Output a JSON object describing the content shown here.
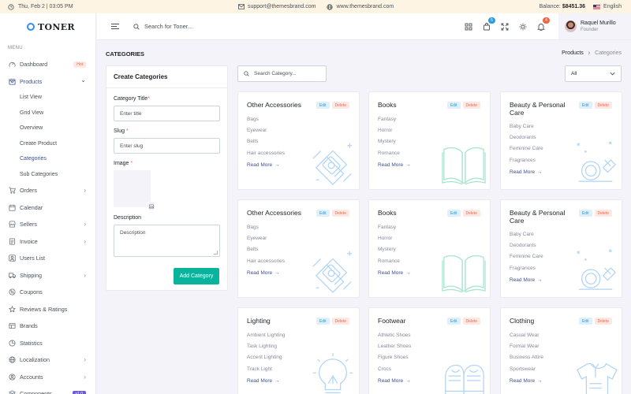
{
  "topbar": {
    "datetime": "Thu, Feb 2 | 03:05 PM",
    "email": "support@themesbrand.com",
    "website": "www.themesbrand.com",
    "balance_label": "Balance:",
    "balance_value": "$8451.36",
    "language": "English"
  },
  "brand": {
    "name": "TONER"
  },
  "sidebar": {
    "menu_title": "MENU",
    "items": [
      {
        "label": "Dashboard",
        "icon": "dashboard-icon",
        "badge": "Hot"
      },
      {
        "label": "Products",
        "icon": "box-icon",
        "active": true,
        "expanded": true,
        "children": [
          "List View",
          "Grid View",
          "Overview",
          "Create Product",
          "Categories",
          "Sub Categories"
        ],
        "active_child": "Categories"
      },
      {
        "label": "Orders",
        "icon": "cart-icon",
        "chevron": true
      },
      {
        "label": "Calendar",
        "icon": "calendar-icon"
      },
      {
        "label": "Sellers",
        "icon": "store-icon",
        "chevron": true
      },
      {
        "label": "Invoice",
        "icon": "invoice-icon",
        "chevron": true
      },
      {
        "label": "Users List",
        "icon": "users-icon"
      },
      {
        "label": "Shipping",
        "icon": "truck-icon",
        "chevron": true
      },
      {
        "label": "Coupons",
        "icon": "coupon-icon"
      },
      {
        "label": "Reviews & Ratings",
        "icon": "star-icon"
      },
      {
        "label": "Brands",
        "icon": "brand-icon"
      },
      {
        "label": "Statistics",
        "icon": "chart-icon"
      },
      {
        "label": "Localization",
        "icon": "globe-icon",
        "chevron": true
      },
      {
        "label": "Accounts",
        "icon": "account-icon",
        "chevron": true
      },
      {
        "label": "Components",
        "icon": "components-icon",
        "badge": "v1.0"
      }
    ]
  },
  "header": {
    "search_placeholder": "Search for Toner...",
    "cart_count": "5",
    "notif_count": "4",
    "user_name": "Raquel Murillo",
    "user_role": "Founder"
  },
  "page": {
    "title": "CATEGORIES",
    "breadcrumb": [
      "Products",
      "Categories"
    ]
  },
  "create_form": {
    "heading": "Create Categories",
    "title_label": "Category Title",
    "title_placeholder": "Enter title",
    "slug_label": "Slug",
    "slug_placeholder": "Enter slug",
    "image_label": "Image",
    "desc_label": "Description",
    "desc_placeholder": "Description",
    "submit": "Add Category"
  },
  "toolbar": {
    "search_placeholder": "Search Category...",
    "filter_value": "All"
  },
  "card_actions": {
    "edit": "Edit",
    "delete": "Delete",
    "read_more": "Read More"
  },
  "categories": [
    {
      "title": "Other Accessories",
      "items": [
        "Bags",
        "Eyewear",
        "Belts",
        "Hair accessories"
      ],
      "illus": "watch"
    },
    {
      "title": "Books",
      "items": [
        "Fantasy",
        "Horror",
        "Mystery",
        "Romance"
      ],
      "illus": "book"
    },
    {
      "title": "Beauty & Personal Care",
      "items": [
        "Baby Care",
        "Deodorants",
        "Feminine Care",
        "Fragrances"
      ],
      "illus": "beauty"
    },
    {
      "title": "Other Accessories",
      "items": [
        "Bags",
        "Eyewear",
        "Belts",
        "Hair accessories"
      ],
      "illus": "watch"
    },
    {
      "title": "Books",
      "items": [
        "Fantasy",
        "Horror",
        "Mystery",
        "Romance"
      ],
      "illus": "book"
    },
    {
      "title": "Beauty & Personal Care",
      "items": [
        "Baby Care",
        "Deodorants",
        "Feminine Care",
        "Fragrances"
      ],
      "illus": "beauty"
    },
    {
      "title": "Lighting",
      "items": [
        "Ambient Lighting",
        "Task Lighting",
        "Accent Lighting",
        "Track Light"
      ],
      "illus": "bulb"
    },
    {
      "title": "Footwear",
      "items": [
        "Athletic Shoes",
        "Leather Shoes",
        "Figure Shoes",
        "Crocs"
      ],
      "illus": "shoes"
    },
    {
      "title": "Clothing",
      "items": [
        "Casual Wear",
        "Formal Wear",
        "Business Attire",
        "Sportswear"
      ],
      "illus": "shirt"
    }
  ],
  "colors": {
    "primary": "#405189",
    "success": "#0ab39c",
    "danger": "#f06548",
    "info": "#299cdb",
    "topbar_bg": "#fef4e4"
  }
}
